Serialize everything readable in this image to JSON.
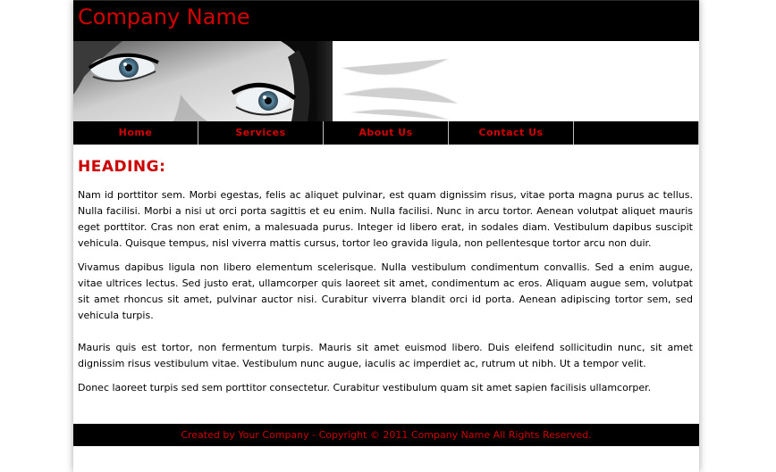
{
  "site": {
    "title": "Company Name"
  },
  "nav": {
    "items": [
      {
        "label": "Home"
      },
      {
        "label": "Services"
      },
      {
        "label": "About Us"
      },
      {
        "label": "Contact Us"
      },
      {
        "label": ""
      }
    ]
  },
  "content": {
    "heading": "HEADING:",
    "paragraphs": [
      "Nam id porttitor sem. Morbi egestas, felis ac aliquet pulvinar, est quam dignissim risus, vitae porta magna purus ac tellus. Nulla facilisi. Morbi a nisi ut orci porta sagittis et eu enim. Nulla facilisi. Nunc in arcu tortor. Aenean volutpat aliquet mauris eget porttitor. Cras non erat enim, a malesuada purus. Integer id libero erat, in sodales diam. Vestibulum dapibus suscipit vehicula. Quisque tempus, nisl viverra mattis cursus, tortor leo gravida ligula, non pellentesque tortor arcu non duir.",
      "Vivamus dapibus ligula non libero elementum scelerisque. Nulla vestibulum condimentum convallis. Sed a enim augue, vitae ultrices lectus. Sed justo erat, ullamcorper quis laoreet sit amet, condimentum ac eros. Aliquam augue sem, volutpat sit amet rhoncus sit amet, pulvinar auctor nisi. Curabitur viverra blandit orci id porta. Aenean adipiscing tortor sem, sed vehicula turpis.",
      "Mauris quis est tortor, non fermentum turpis. Mauris sit amet euismod libero. Duis eleifend sollicitudin nunc, sit amet dignissim risus vestibulum vitae. Vestibulum nunc augue, iaculis ac imperdiet ac, rutrum ut nibh. Ut a tempor velit.",
      "Donec laoreet turpis sed sem porttitor consectetur. Curabitur vestibulum quam sit amet sapien facilisis ullamcorper."
    ]
  },
  "footer": {
    "text": "Created by Your Company - Copyright © 2011 Company Name All Rights Reserved."
  },
  "colors": {
    "accent": "#d40000",
    "bar": "#000000",
    "background": "#ffffff"
  }
}
